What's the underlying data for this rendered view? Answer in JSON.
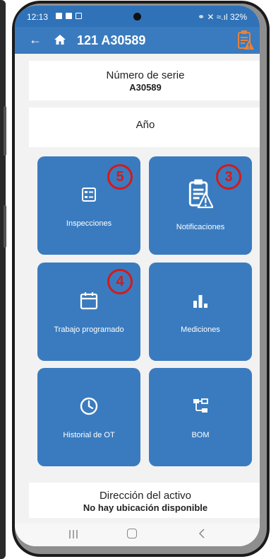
{
  "status_bar": {
    "time": "12:13",
    "right": "⚭ ✕ ≈.ıl 32%"
  },
  "app_bar": {
    "title": "121 A30589"
  },
  "serial": {
    "label": "Número de serie",
    "value": "A30589"
  },
  "year": {
    "label": "Año"
  },
  "tiles": [
    {
      "label": "Inspecciones",
      "icon": "checklist-icon",
      "badge": "5"
    },
    {
      "label": "Notificaciones",
      "icon": "clipboard-warning-icon",
      "badge": "3"
    },
    {
      "label": "Trabajo programado",
      "icon": "calendar-icon",
      "badge": "4"
    },
    {
      "label": "Mediciones",
      "icon": "bar-chart-icon"
    },
    {
      "label": "Historial de OT",
      "icon": "clock-icon"
    },
    {
      "label": "BOM",
      "icon": "hierarchy-icon"
    }
  ],
  "address": {
    "label": "Dirección del activo",
    "value": "No hay ubicación disponible"
  },
  "colors": {
    "primary": "#3a7bbf",
    "status_bar": "#2f72b8",
    "badge": "#d41a1a",
    "notification_icon": "#e8823a"
  }
}
